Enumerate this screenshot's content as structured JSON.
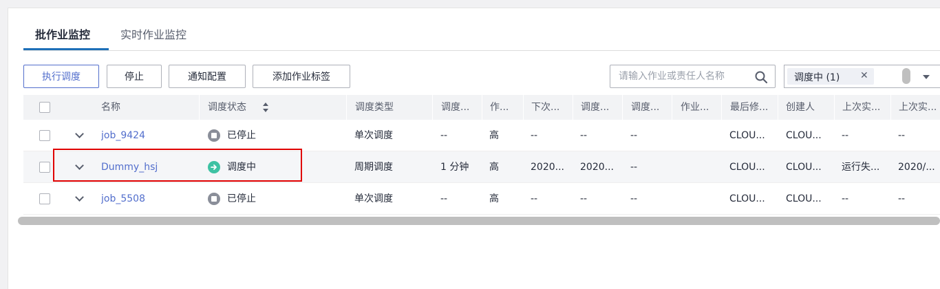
{
  "tabs": [
    {
      "label": "批作业监控",
      "active": true
    },
    {
      "label": "实时作业监控",
      "active": false
    }
  ],
  "toolbar": {
    "buttons": [
      "执行调度",
      "停止",
      "通知配置",
      "添加作业标签"
    ],
    "search_placeholder": "请输入作业或责任人名称",
    "filter_tag": "调度中 (1)",
    "filter_close": "✕"
  },
  "table": {
    "columns": [
      "名称",
      "调度状态",
      "调度类型",
      "调度...",
      "作...",
      "下次...",
      "调度...",
      "调度...",
      "作业...",
      "最后修...",
      "创建人",
      "上次实...",
      "上次实..."
    ],
    "rows": [
      {
        "name": "job_9424",
        "status": "已停止",
        "status_type": "stopped",
        "cells": [
          "单次调度",
          "--",
          "高",
          "--",
          "--",
          "--",
          "",
          "CLOU...",
          "CLOU...",
          "--",
          "--"
        ]
      },
      {
        "name": "Dummy_hsj",
        "status": "调度中",
        "status_type": "running",
        "cells": [
          "周期调度",
          "1 分钟",
          "高",
          "2020...",
          "2020...",
          "--",
          "",
          "CLOU...",
          "CLOU...",
          "运行失...",
          "2020/..."
        ]
      },
      {
        "name": "job_5508",
        "status": "已停止",
        "status_type": "stopped",
        "cells": [
          "单次调度",
          "--",
          "高",
          "--",
          "--",
          "--",
          "",
          "CLOU...",
          "CLOU...",
          "--",
          "--"
        ]
      }
    ]
  },
  "colors": {
    "accent": "#526ecc",
    "tab_underline": "#1d6fb8",
    "running": "#3ec2a3",
    "stopped": "#8a8e99",
    "highlight": "#e00000"
  }
}
